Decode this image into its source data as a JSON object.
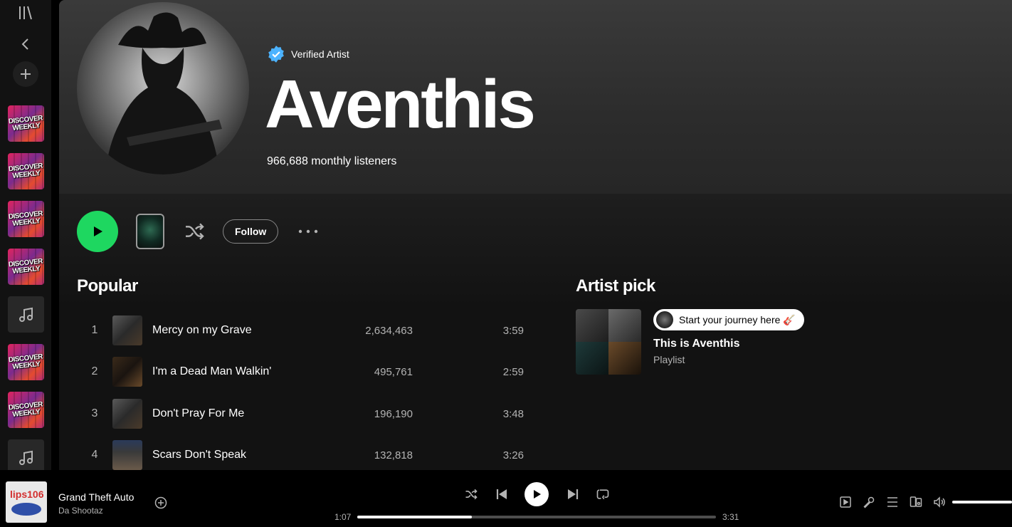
{
  "sidebar": {
    "tiles": [
      {
        "type": "discover",
        "label": "DISCOVER WEEKLY"
      },
      {
        "type": "discover",
        "label": "DISCOVER WEEKLY"
      },
      {
        "type": "discover",
        "label": "DISCOVER WEEKLY"
      },
      {
        "type": "discover",
        "label": "DISCOVER WEEKLY"
      },
      {
        "type": "note"
      },
      {
        "type": "discover",
        "label": "DISCOVER WEEKLY"
      },
      {
        "type": "discover",
        "label": "DISCOVER WEEKLY"
      },
      {
        "type": "note"
      }
    ],
    "icons": [
      "library-icon",
      "back-icon",
      "add-icon"
    ]
  },
  "artist": {
    "verified_label": "Verified Artist",
    "name": "Aventhis",
    "listeners": "966,688 monthly listeners"
  },
  "actions": {
    "follow_label": "Follow"
  },
  "popular": {
    "title": "Popular",
    "tracks": [
      {
        "num": "1",
        "title": "Mercy on my Grave",
        "plays": "2,634,463",
        "duration": "3:59"
      },
      {
        "num": "2",
        "title": "I'm a Dead Man Walkin'",
        "plays": "495,761",
        "duration": "2:59"
      },
      {
        "num": "3",
        "title": "Don't Pray For Me",
        "plays": "196,190",
        "duration": "3:48"
      },
      {
        "num": "4",
        "title": "Scars Don't Speak",
        "plays": "132,818",
        "duration": "3:26"
      }
    ]
  },
  "artist_pick": {
    "title": "Artist pick",
    "badge": "Start your journey here 🎸",
    "item_title": "This is Aventhis",
    "item_type": "Playlist"
  },
  "player": {
    "cover_text": "lips106",
    "track_title": "Grand Theft Auto",
    "track_artist": "Da Shootaz",
    "elapsed": "1:07",
    "total": "3:31",
    "progress": 0.32,
    "volume": 1.0
  },
  "colors": {
    "accent": "#1ed760",
    "background": "#121212",
    "secondary_text": "#b3b3b3"
  }
}
